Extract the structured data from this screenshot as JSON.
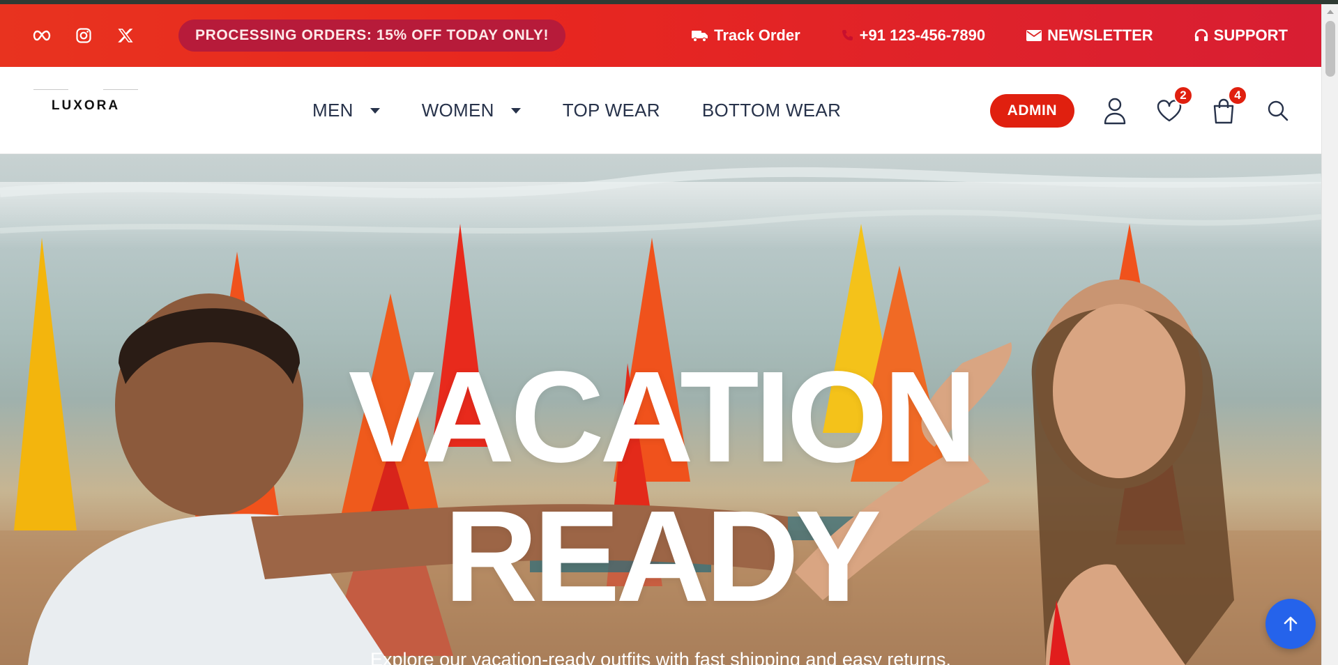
{
  "topbar": {
    "social_icons": [
      "meta-icon",
      "instagram-icon",
      "x-icon"
    ],
    "promo": "PROCESSING ORDERS: 15% OFF TODAY ONLY!",
    "links": {
      "track_order": "Track Order",
      "phone": "+91 123-456-7890",
      "newsletter": "NEWSLETTER",
      "support": "SUPPORT"
    }
  },
  "header": {
    "logo": "LUXORA",
    "nav": {
      "men": "MEN",
      "women": "WOMEN",
      "top_wear": "TOP WEAR",
      "bottom_wear": "BOTTOM WEAR"
    },
    "admin_label": "ADMIN",
    "wishlist_count": "2",
    "cart_count": "4"
  },
  "hero": {
    "title_line1": "VACATION",
    "title_line2": "READY",
    "subtitle": "Explore our vacation-ready outfits with fast shipping and easy returns."
  },
  "colors": {
    "accent": "#e0200f",
    "topbar_start": "#e8331f",
    "topbar_end": "#d81e33",
    "promo_pill": "#b71b3a",
    "scroll_top": "#2563eb",
    "nav_text": "#27324a"
  }
}
